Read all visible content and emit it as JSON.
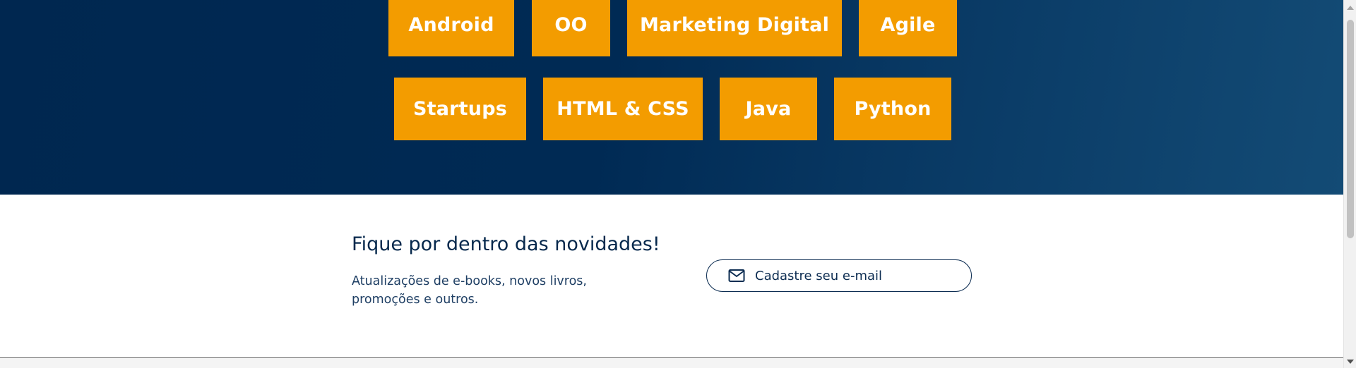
{
  "tags": {
    "android": "Android",
    "oo": "OO",
    "marketing_digital": "Marketing Digital",
    "agile": "Agile",
    "startups": "Startups",
    "html_css": "HTML & CSS",
    "java": "Java",
    "python": "Python"
  },
  "newsletter": {
    "title": "Fique por dentro das novidades!",
    "description": "Atualizações de e-books, novos livros, promoções e outros.",
    "email_placeholder": "Cadastre seu e-mail",
    "icon": "mail-icon"
  },
  "colors": {
    "hero_background": "#002750",
    "tag_background": "#f39c00",
    "tag_text": "#ffffff",
    "newsletter_text": "#06284c"
  }
}
